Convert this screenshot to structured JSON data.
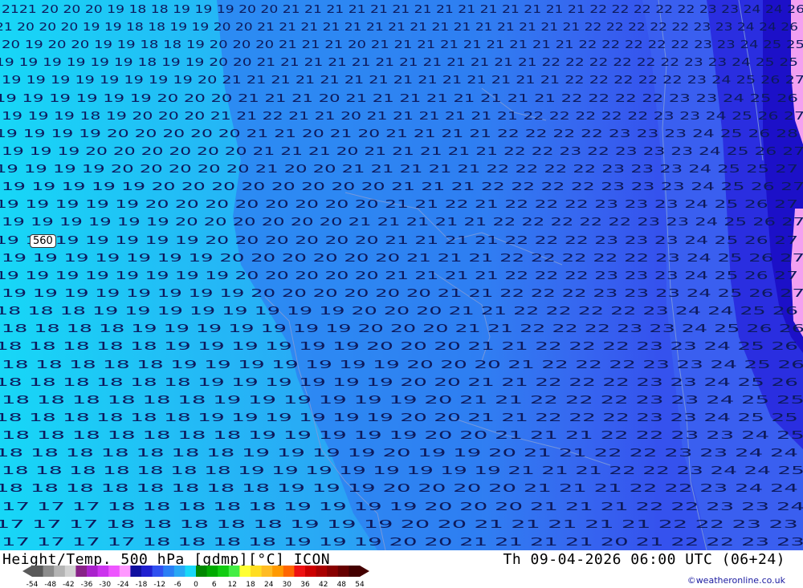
{
  "header": {
    "title": "Height/Temp. 500 hPa [gdmp][°C] ICON",
    "datetime": "Th 09-04-2026 06:00 UTC (06+24)",
    "copyright": "©weatheronline.co.uk"
  },
  "map": {
    "height_label": "560",
    "field_colors": {
      "cyan": "#17d7f7",
      "light_blue": "#2aaaf5",
      "mid_blue": "#2f7ef2",
      "blue": "#3a5ff0",
      "deep_blue": "#2a2ee0",
      "navy": "#1c10c8",
      "magenta": "#f3a0f0"
    },
    "temperature_rows": [
      "2121 20 20 20 19 18 18 19 19 19 20 20 21 21 21 21 21 21 21 21 21 21 21 21 21 21 22 22 22 22 22 23 23 24 24 26",
      "21 20 20 20 19 19 18 18 19 19 20 20 21 21 21 21 21 21 21 21 21 21 21 21 21 21 21 22 22 22 22 22 23 23 24 24 26",
      "20 19 20 20 19 19 18 18 19 20 20 20 21 21 21 20 21 21 21 21 21 21 21 21 21 22 22 22 22 22 23 23 24 25 25",
      "19 19 19 19 19 19 18 19 19 20 20 21 21 21 21 21 21 21 21 21 21 21 21 22 22 22 22 22 22 23 23 24 25 25",
      "19 19 19 19 19 19 19 19 20 21 21 21 21 21 21 21 21 21 21 21 21 21 21 22 22 22 22 22 23 24 25 26 27",
      "19 19 19 19 19 19 20 20 20 21 21 21 20 21 21 21 21 21 21 21 21 22 22 22 22 23 23 24 25 26",
      "19 19 19 18 19 20 20 20 21 21 22 21 21 20 21 21 21 21 21 21 22 22 22 22 22 23 23 24 25 26 27",
      "19 19 19 19 20 20 20 20 20 21 21 20 21 20 21 21 21 21 22 22 22 22 23 23 23 24 25 26 28",
      "19 19 19 20 20 20 20 20 20 21 21 21 20 21 21 21 21 21 22 22 23 22 23 23 23 24 25 26 27",
      "19 19 19 19 20 20 20 20 20 21 20 20 21 21 21 21 21 22 22 22 22 23 23 23 24 25 25 27",
      "19 19 19 19 19 20 20 20 20 20 20 20 20 21 21 21 22 22 22 22 23 23 23 24 25 26 27",
      "19 19 19 19 19 20 20 20 20 20 20 20 20 21 21 22 21 22 22 22 23 23 23 24 25 26 27",
      "19 19 19 19 19 19 20 20 20 20 20 20 21 21 21 21 21 22 22 22 22 22 23 23 24 25 26 27",
      "19 19 19 19 19 19 19 20 20 20 20 20 20 21 21 21 21 22 22 22 23 23 23 24 25 26 27",
      "19 19 19 19 19 19 19 20 20 20 20 20 20 21 21 21 22 22 22 22 22 23 24 25 26 27",
      "19 19 19 19 19 19 19 19 20 20 20 20 20 21 21 21 21 22 22 22 23 23 23 24 25 26 27",
      "19 19 19 19 19 19 19 19 20 20 20 20 20 20 21 21 22 22 22 23 23 23 24 25 26 27",
      "18 18 18 19 19 19 19 19 19 19 19 20 20 20 21 21 22 22 22 22 23 24 24 25 26",
      "18 18 18 18 19 19 19 19 19 19 19 20 20 20 21 21 22 22 22 23 23 24 25 26 26",
      "18 18 18 18 18 19 19 19 19 19 19 20 20 20 21 21 22 22 22 23 23 24 25 26",
      "18 18 18 18 18 19 19 19 19 19 19 19 20 20 20 21 22 22 22 23 23 24 25 26",
      "18 18 18 18 18 18 19 19 19 19 19 19 20 20 21 21 22 22 22 23 23 24 25 26",
      "18 18 18 18 18 18 19 19 19 19 19 19 20 21 21 22 22 22 23 23 24 25 25",
      "18 18 18 18 18 18 19 19 19 19 19 19 20 20 21 21 22 22 22 23 23 24 25 25",
      "18 18 18 18 18 18 18 19 19 19 19 19 20 20 21 21 21 22 22 23 23 24 25",
      "18 18 18 18 18 18 18 19 19 19 19 20 19 19 20 21 21 22 22 23 23 24 24",
      "18 18 18 18 18 18 18 19 19 19 19 19 19 19 19 21 21 21 22 22 23 24 24 25",
      "18 18 18 18 18 18 18 18 19 19 19 20 20 20 20 21 21 21 22 22 23 24 24",
      "17 17 17 18 18 18 18 18 19 19 19 19 20 20 20 21 21 21 22 22 23 23 24",
      "17 17 17 18 18 18 18 18 19 19 19 20 20 21 21 21 21 21 22 22 23 23",
      "17 17 17 17 18 18 18 18 19 19 19 20 20 21 21 21 21 20 21 22 22 23 23"
    ]
  },
  "legend": {
    "colors": [
      "#5a5a5a",
      "#8c8c8c",
      "#b4b4b4",
      "#d2d2d2",
      "#882288",
      "#aa22cc",
      "#cc33ee",
      "#ee55ff",
      "#ff99ff",
      "#1010a0",
      "#2020d0",
      "#3050f0",
      "#2a7ff5",
      "#28a8f5",
      "#18d8f8",
      "#008800",
      "#00aa00",
      "#11cc11",
      "#44ee44",
      "#ffff33",
      "#ffdd22",
      "#ffbb22",
      "#ff9900",
      "#ff6600",
      "#ee1111",
      "#cc0000",
      "#aa0000",
      "#880000",
      "#660000",
      "#440000"
    ],
    "ticks": [
      "-54",
      "-48",
      "-42",
      "-36",
      "-30",
      "-24",
      "-18",
      "-12",
      "-6",
      "0",
      "6",
      "12",
      "18",
      "24",
      "30",
      "36",
      "42",
      "48",
      "54"
    ]
  }
}
